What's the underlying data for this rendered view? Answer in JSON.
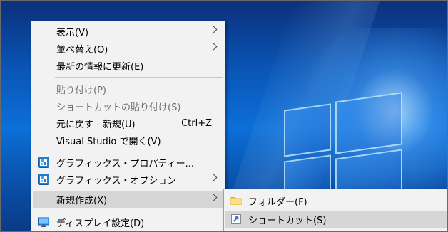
{
  "context_menu": {
    "items": [
      {
        "label": "表示(V)"
      },
      {
        "label": "並べ替え(O)"
      },
      {
        "label": "最新の情報に更新(E)"
      },
      {
        "label": "貼り付け(P)"
      },
      {
        "label": "ショートカットの貼り付け(S)"
      },
      {
        "label": "元に戻す - 新規(U)",
        "shortcut": "Ctrl+Z"
      },
      {
        "label": "Visual Studio で開く(V)"
      },
      {
        "label": "グラフィックス・プロパティー...",
        "icon": "intel-graphics-icon"
      },
      {
        "label": "グラフィックス・オプション",
        "icon": "intel-graphics-icon"
      },
      {
        "label": "新規作成(X)"
      },
      {
        "label": "ディスプレイ設定(D)",
        "icon": "display-icon"
      }
    ]
  },
  "new_submenu": {
    "items": [
      {
        "label": "フォルダー(F)",
        "icon": "folder-icon"
      },
      {
        "label": "ショートカット(S)",
        "icon": "shortcut-icon"
      }
    ]
  },
  "colors": {
    "menu_bg": "#f2f2f2",
    "highlight_bg": "#d6d6d6",
    "disabled_text": "#6d6d6d",
    "desktop_blue": "#0a56b6"
  }
}
